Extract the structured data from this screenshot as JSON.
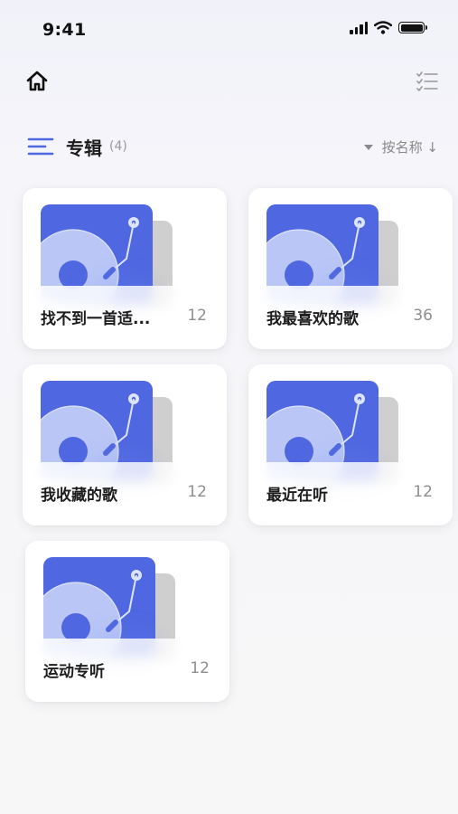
{
  "status_bar": {
    "time": "9:41"
  },
  "header": {
    "title": "专辑",
    "count": "(4)",
    "sort_label": "按名称 ↓"
  },
  "albums": [
    {
      "name": "找不到一首适...",
      "count": "12"
    },
    {
      "name": "我最喜欢的歌",
      "count": "36"
    },
    {
      "name": "我收藏的歌",
      "count": "12"
    },
    {
      "name": "最近在听",
      "count": "12"
    },
    {
      "name": "运动专听",
      "count": "12"
    }
  ],
  "colors": {
    "accent": "#4f67e0",
    "cover_light": "#b9c6f6",
    "text_primary": "#1c1c1c",
    "text_secondary": "#8e8e8e"
  },
  "icons": {
    "home": "home-icon",
    "list": "checklist-icon",
    "menu": "menu-lines-icon",
    "sort_arrow": "triangle-down-icon",
    "album_cover": "vinyl-record-icon"
  }
}
